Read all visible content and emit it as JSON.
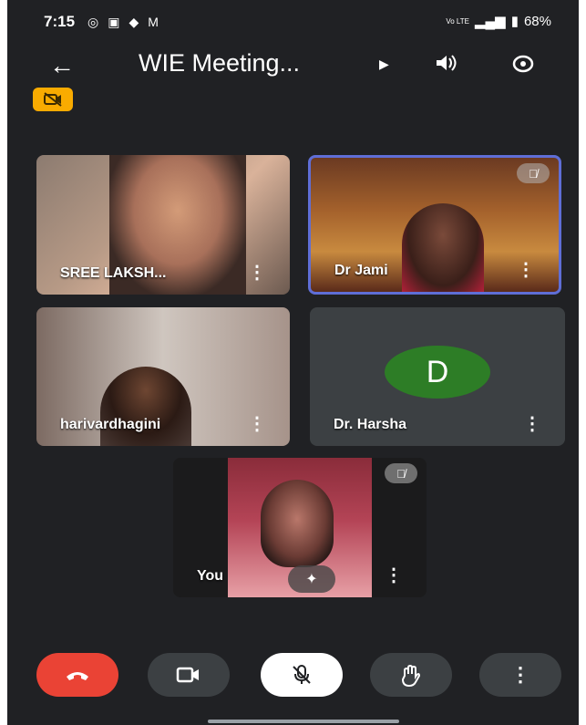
{
  "status": {
    "time": "7:15",
    "left_icons": [
      "whatsapp-icon",
      "calendar-icon",
      "app-icon",
      "gmail-icon"
    ],
    "battery": "68%",
    "signal_text": "Vo LTE"
  },
  "header": {
    "title": "WIE Meeting...",
    "back_label": "←"
  },
  "participants": [
    {
      "name": "SREE LAKSH...",
      "muted": false,
      "has_video": true
    },
    {
      "name": "Dr Jami",
      "muted": true,
      "has_video": true
    },
    {
      "name": "harivardhagini",
      "muted": false,
      "has_video": true
    },
    {
      "name": "Dr. Harsha",
      "muted": false,
      "has_video": false,
      "avatar_letter": "D",
      "avatar_color": "#2d7d26"
    },
    {
      "name": "You",
      "muted": true,
      "has_video": true
    }
  ],
  "colors": {
    "background": "#202124",
    "tile": "#3c4043",
    "end_call": "#ea4335",
    "mute_button": "#ffffff",
    "badge": "#f9ab00"
  }
}
